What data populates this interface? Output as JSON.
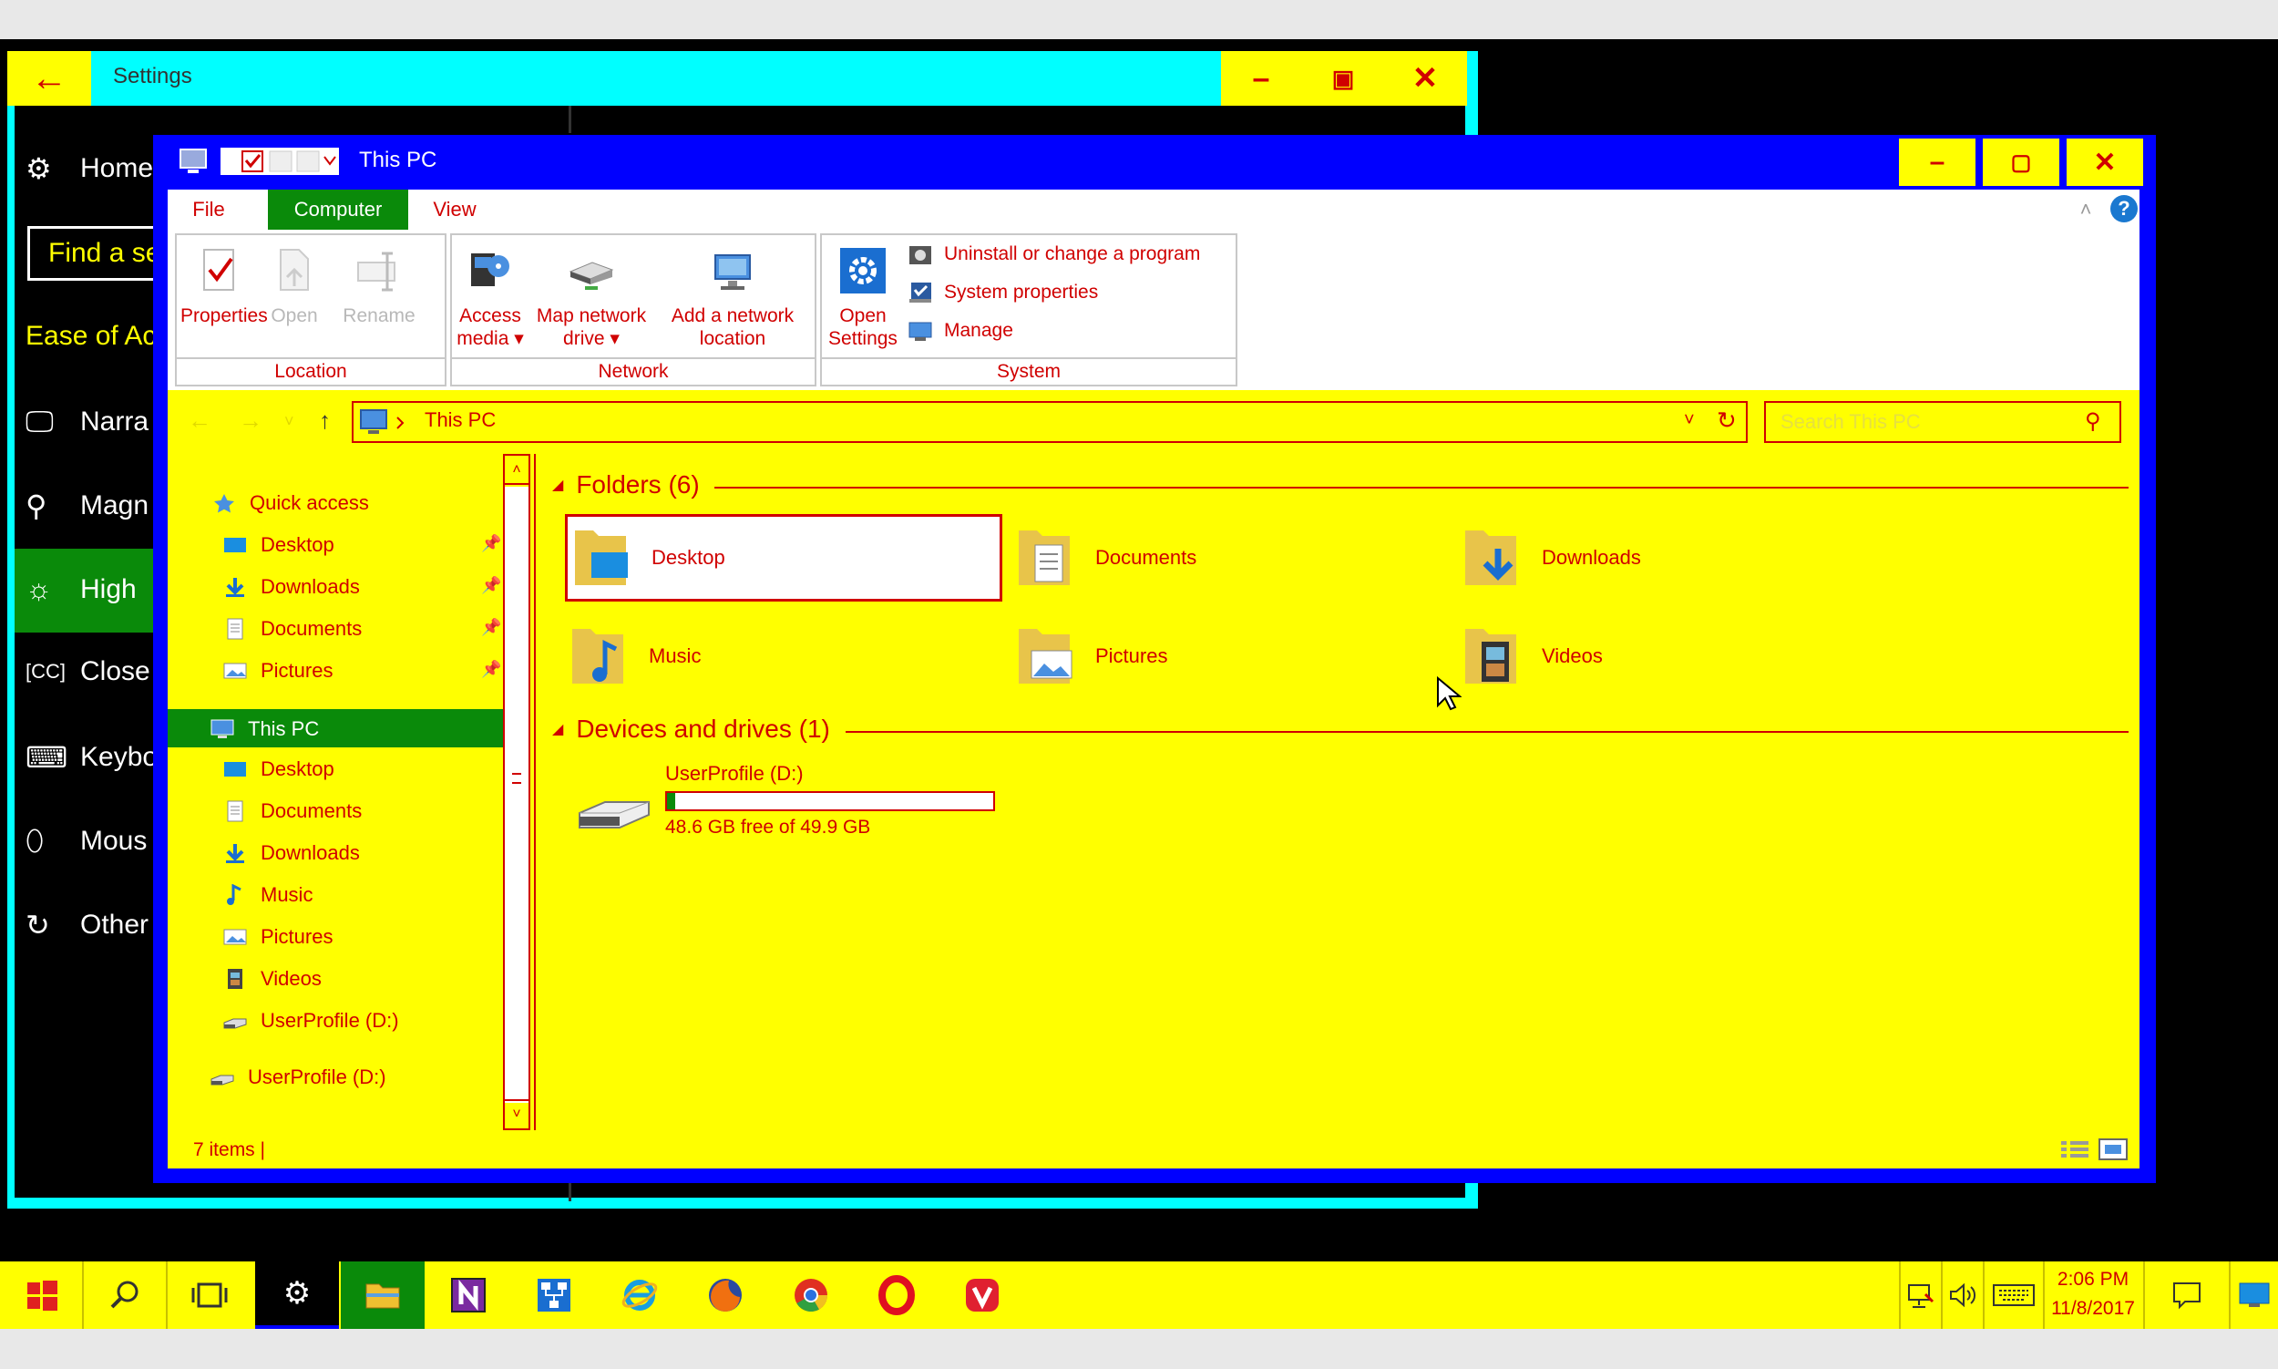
{
  "settings": {
    "title": "Settings",
    "nav": [
      {
        "label": "Home",
        "icon": "gear-icon"
      },
      {
        "label": "Narra",
        "icon": "narrator-icon"
      },
      {
        "label": "Magn",
        "icon": "magnifier-icon"
      },
      {
        "label": "High",
        "icon": "brightness-icon"
      },
      {
        "label": "Close",
        "icon": "closed-captions-icon"
      },
      {
        "label": "Keybo",
        "icon": "keyboard-icon"
      },
      {
        "label": "Mous",
        "icon": "mouse-icon"
      },
      {
        "label": "Other",
        "icon": "refresh-icon"
      }
    ],
    "search_text": "Find a se",
    "section": "Ease of Acc"
  },
  "explorer": {
    "title": "This PC",
    "tabs": [
      "File",
      "Computer",
      "View"
    ],
    "ribbon": {
      "location": {
        "label": "Location",
        "buttons": [
          "Properties",
          "Open",
          "Rename"
        ]
      },
      "network": {
        "label": "Network",
        "buttons": [
          {
            "line1": "Access",
            "line2": "media ▾"
          },
          {
            "line1": "Map network",
            "line2": "drive ▾"
          },
          {
            "line1": "Add a network",
            "line2": "location"
          }
        ]
      },
      "system": {
        "label": "System",
        "open_line1": "Open",
        "open_line2": "Settings",
        "items": [
          "Uninstall or change a program",
          "System properties",
          "Manage"
        ]
      }
    },
    "address": "This PC",
    "search_placeholder": "Search This PC",
    "tree": {
      "quick_access": "Quick access",
      "quick_items": [
        "Desktop",
        "Downloads",
        "Documents",
        "Pictures"
      ],
      "this_pc": "This PC",
      "pc_items": [
        "Desktop",
        "Documents",
        "Downloads",
        "Music",
        "Pictures",
        "Videos",
        "UserProfile (D:)"
      ],
      "drive": "UserProfile (D:)"
    },
    "folders_header": "Folders (6)",
    "folders": [
      "Desktop",
      "Documents",
      "Downloads",
      "Music",
      "Pictures",
      "Videos"
    ],
    "devices_header": "Devices and drives (1)",
    "drive": {
      "name": "UserProfile (D:)",
      "free_text": "48.6 GB free of 49.9 GB",
      "used_fraction": 0.026
    },
    "status": "7 items  |"
  },
  "taskbar": {
    "apps": [
      "start-icon",
      "search-icon",
      "task-view-icon",
      "settings-icon",
      "file-explorer-icon",
      "onenote-icon",
      "network-app-icon",
      "internet-explorer-icon",
      "firefox-icon",
      "chrome-icon",
      "opera-icon",
      "vivaldi-icon"
    ],
    "time": "2:06 PM",
    "date": "11/8/2017"
  },
  "colors": {
    "accent": "#ffff00",
    "text": "#d00000",
    "title_bar": "#0000ff",
    "selection": "#0a8a0a",
    "settings_bar": "#00ffff"
  }
}
